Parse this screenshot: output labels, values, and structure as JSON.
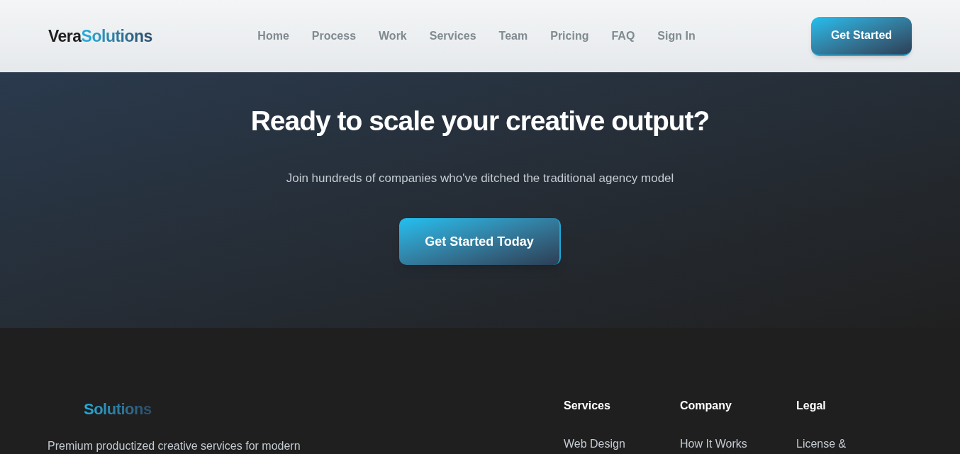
{
  "header": {
    "logo": {
      "part_1": "Vera",
      "part_2": "Solutions"
    },
    "nav": [
      {
        "label": "Home"
      },
      {
        "label": "Process"
      },
      {
        "label": "Work"
      },
      {
        "label": "Services"
      },
      {
        "label": "Team"
      },
      {
        "label": "Pricing"
      },
      {
        "label": "FAQ"
      },
      {
        "label": "Sign In"
      }
    ],
    "cta": "Get Started"
  },
  "hero": {
    "title": "Ready to scale your creative output?",
    "subtitle": "Join hundreds of companies who've ditched the traditional agency model",
    "cta": "Get Started Today"
  },
  "footer": {
    "logo": "Solutions",
    "tagline": "Premium productized creative services for modern",
    "columns": [
      {
        "heading": "Services",
        "links": [
          "Web Design"
        ]
      },
      {
        "heading": "Company",
        "links": [
          "How It Works"
        ]
      },
      {
        "heading": "Legal",
        "links": [
          "License &"
        ]
      }
    ]
  }
}
